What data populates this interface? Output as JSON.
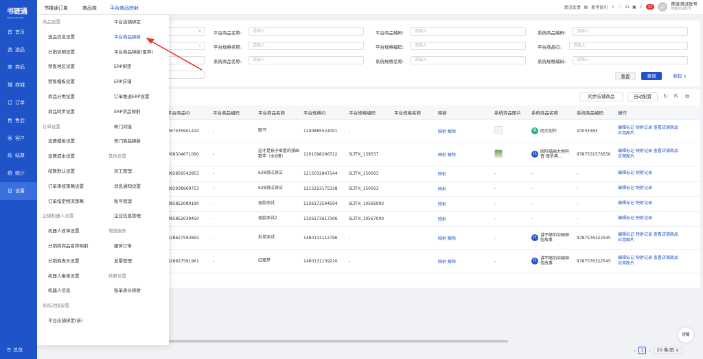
{
  "logo": {
    "title": "书链通",
    "subtitle": "SHULIANTONG"
  },
  "sidebar": {
    "items": [
      {
        "icon": "首",
        "label": "首页"
      },
      {
        "icon": "选",
        "label": "选品"
      },
      {
        "icon": "商",
        "label": "商品"
      },
      {
        "icon": "城",
        "label": "商城"
      },
      {
        "icon": "订",
        "label": "订单"
      },
      {
        "icon": "售",
        "label": "售后"
      },
      {
        "icon": "客",
        "label": "客户"
      },
      {
        "icon": "结",
        "label": "结算"
      },
      {
        "icon": "统",
        "label": "统计"
      },
      {
        "icon": "设",
        "label": "设置"
      }
    ],
    "bottom": "总览"
  },
  "topbar": {
    "tabs": [
      "书链通订单",
      "商品库",
      "平台商品映射"
    ],
    "feedback": "意见反馈",
    "guide": "新手指引",
    "notif_count": "32",
    "account_name": "育链测试账号",
    "account_sub": "育链测试账号"
  },
  "filter": {
    "labels": [
      "平台商品名称:",
      "平台商品编码:",
      "系统商品编码:",
      "平台规格名称:",
      "平台规格编码:",
      "平台商品ID:",
      "系统商品名称:",
      "系统规格名称:",
      "系统规格编码:"
    ],
    "placeholder": "请输入",
    "reset": "重置",
    "search": "查询",
    "collapse": "收起 ∧"
  },
  "toolbar": {
    "sync": "同步店铺商品",
    "auto": "自动配置"
  },
  "table": {
    "headers": [
      "平台商品ID",
      "平台商品编码",
      "平台商品名称",
      "平台规格ID",
      "平台规格编码",
      "平台规格名称",
      "映射",
      "系统商品图片",
      "系统商品名称",
      "系统商品编码",
      "操作"
    ],
    "map_link": "映射",
    "unmap_link": "解除",
    "op_edit": "编辑标记",
    "op_log": "映射记录",
    "op_view": "查看店铺商品",
    "op_apply": "应用图片",
    "rows": [
      {
        "pid": "767535901410",
        "pcode": "-",
        "pname": "图书",
        "sid": "1200885524001",
        "scode": "-",
        "sname": "",
        "unmap": true,
        "img": "blank",
        "shop_ic": "网",
        "shop_color": "#22b07d",
        "shop": "网文创作",
        "code": "10035383",
        "full": true
      },
      {
        "pid": "768504671060",
        "pcode": "-",
        "pname": "这才是孩子爱看的漫画数学（全6册）",
        "sid": "1201098296722",
        "scode": "SLTFX_139537",
        "sname": "",
        "unmap": true,
        "img": "photo",
        "shop_ic": "代",
        "shop_color": "#1f54c8",
        "shop": "国际描画大地科普·保罗典...",
        "code": "9787531576556",
        "full": true
      },
      {
        "pid": "382856542853",
        "pcode": "-",
        "pname": "628测试测试",
        "sid": "1215032847144",
        "scode": "SLTFX_150563",
        "sname": "",
        "unmap": false,
        "img": "",
        "shop_ic": "",
        "shop_color": "",
        "shop": "-",
        "code": "-",
        "full": false
      },
      {
        "pid": "382938969753",
        "pcode": "-",
        "pname": "628测试测试",
        "sid": "1215223175338",
        "scode": "SLTFX_150563",
        "sname": "",
        "unmap": false,
        "img": "",
        "shop_ic": "",
        "shop_color": "",
        "shop": "-",
        "code": "-",
        "full": false
      },
      {
        "pid": "385852089190",
        "pcode": "-",
        "pname": "退款测试",
        "sid": "1326173594504",
        "scode": "SLTFX_10566993",
        "sname": "",
        "unmap": false,
        "img": "",
        "shop_ic": "",
        "shop_color": "",
        "shop": "-",
        "code": "-",
        "full": false
      },
      {
        "pid": "385852039450",
        "pcode": "-",
        "pname": "退款测试2",
        "sid": "1326173617306",
        "scode": "SLTFX_10567000",
        "sname": "",
        "unmap": false,
        "img": "",
        "shop_ic": "",
        "shop_color": "",
        "shop": "-",
        "code": "-",
        "full": false
      },
      {
        "pid": "528627593893",
        "pcode": "-",
        "pname": "拆单测试",
        "sid": "1460131112796",
        "scode": "-",
        "sname": "",
        "unmap": true,
        "img": "",
        "shop_ic": "代",
        "shop_color": "#1f54c8",
        "shop": "讲不够的中国神信故事",
        "code": "9787576322545",
        "full": true
      },
      {
        "pid": "528627591961",
        "pcode": "-",
        "pname": "红楼梦",
        "sid": "1460131139220",
        "scode": "-",
        "sname": "",
        "unmap": true,
        "img": "",
        "shop_ic": "代",
        "shop_color": "#1f54c8",
        "shop": "讲不够的中国神信故事",
        "code": "9787576322545",
        "full": true
      }
    ]
  },
  "pager": {
    "current": "1",
    "size": "20 条/页"
  },
  "help": "提醒",
  "menu": {
    "left": [
      {
        "t": "sec",
        "label": "商品设置"
      },
      {
        "t": "item",
        "label": "选品信息设置"
      },
      {
        "t": "item",
        "label": "分销说明设置"
      },
      {
        "t": "item",
        "label": "禁售地区设置"
      },
      {
        "t": "item",
        "label": "禁售模板设置"
      },
      {
        "t": "item",
        "label": "商品分类设置"
      },
      {
        "t": "item",
        "label": "商品同步设置"
      },
      {
        "t": "sec",
        "label": "订单设置"
      },
      {
        "t": "item",
        "label": "运费模板设置"
      },
      {
        "t": "item",
        "label": "运费成本设置"
      },
      {
        "t": "item",
        "label": "结算默认设置"
      },
      {
        "t": "item",
        "label": "订单审核策略设置"
      },
      {
        "t": "item",
        "label": "订单指定物流策略"
      },
      {
        "t": "sec",
        "label": "企微机器人设置"
      },
      {
        "t": "item",
        "label": "机器人收单设置"
      },
      {
        "t": "item",
        "label": "分销商商品名称映射"
      },
      {
        "t": "item",
        "label": "分销商表头设置"
      },
      {
        "t": "item",
        "label": "机器人推单设置"
      },
      {
        "t": "item",
        "label": "机器人信息"
      },
      {
        "t": "sec",
        "label": "系统对接设置"
      },
      {
        "t": "item",
        "label": "平台店铺绑定(新)"
      }
    ],
    "right": [
      {
        "t": "item",
        "label": "平台店铺绑定"
      },
      {
        "t": "item",
        "label": "平台商品映射",
        "active": true
      },
      {
        "t": "item",
        "label": "平台商品映射(废弃)"
      },
      {
        "t": "item",
        "label": "ERP绑定"
      },
      {
        "t": "item",
        "label": "ERP店铺"
      },
      {
        "t": "item",
        "label": "订单推送ERP设置"
      },
      {
        "t": "item",
        "label": "ERP货品映射"
      },
      {
        "t": "item",
        "label": "奇门对接"
      },
      {
        "t": "item",
        "label": "奇门商品映射"
      },
      {
        "t": "sec",
        "label": "其他设置"
      },
      {
        "t": "item",
        "label": "员工管理"
      },
      {
        "t": "item",
        "label": "消息通知设置"
      },
      {
        "t": "item",
        "label": "账号管理"
      },
      {
        "t": "item",
        "label": "企业信息管理"
      },
      {
        "t": "sec",
        "label": "增值服务"
      },
      {
        "t": "item",
        "label": "服务订单"
      },
      {
        "t": "item",
        "label": "发票管理"
      },
      {
        "t": "sec",
        "label": "结算设置"
      },
      {
        "t": "item",
        "label": "账单表头映射"
      }
    ]
  },
  "colors": {
    "brand": "#1f54c8",
    "annotation_arrow": "#e53935"
  }
}
